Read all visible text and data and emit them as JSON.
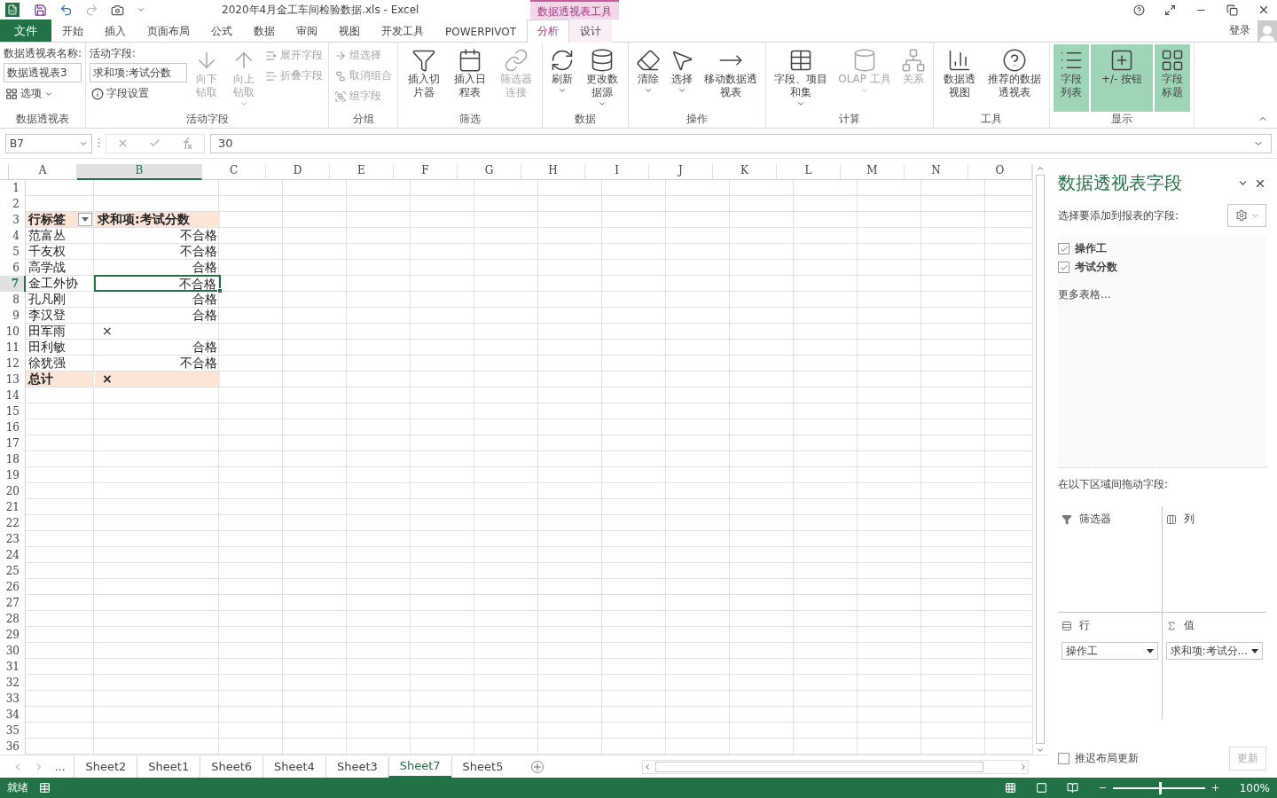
{
  "window": {
    "title": "2020年4月金工车间检验数据.xls - Excel",
    "context_tab": "数据透视表工具",
    "account": "登录"
  },
  "tabs": [
    {
      "label": "文件",
      "kind": "file",
      "selected": false
    },
    {
      "label": "开始",
      "kind": "tab",
      "selected": false
    },
    {
      "label": "插入",
      "kind": "tab",
      "selected": false
    },
    {
      "label": "页面布局",
      "kind": "tab",
      "selected": false
    },
    {
      "label": "公式",
      "kind": "tab",
      "selected": false
    },
    {
      "label": "数据",
      "kind": "tab",
      "selected": false
    },
    {
      "label": "审阅",
      "kind": "tab",
      "selected": false
    },
    {
      "label": "视图",
      "kind": "tab",
      "selected": false
    },
    {
      "label": "开发工具",
      "kind": "tab",
      "selected": false
    },
    {
      "label": "POWERPIVOT",
      "kind": "tab",
      "selected": false
    },
    {
      "label": "分析",
      "kind": "context",
      "selected": true
    },
    {
      "label": "设计",
      "kind": "context",
      "selected": false
    }
  ],
  "ribbon": [
    {
      "label": "数据透视表",
      "items": [
        {
          "kind": "caption",
          "label": "数据透视表名称:"
        },
        {
          "kind": "field",
          "value": "数据透视表3"
        },
        {
          "kind": "small",
          "label": "选项",
          "dropdown": true,
          "disabled": false
        }
      ]
    },
    {
      "label": "活动字段",
      "items": [
        {
          "kind": "caption",
          "label": "活动字段:"
        },
        {
          "kind": "field",
          "value": "求和项:考试分数"
        },
        {
          "kind": "small",
          "label": "字段设置",
          "dropdown": false,
          "disabled": false
        },
        {
          "kind": "big",
          "label": "向下钻取",
          "dropdown": false,
          "disabled": true,
          "selected": false
        },
        {
          "kind": "big",
          "label": "向上钻取",
          "dropdown": true,
          "disabled": true,
          "selected": false
        },
        {
          "kind": "small",
          "label": "展开字段",
          "dropdown": false,
          "disabled": true
        },
        {
          "kind": "small",
          "label": "折叠字段",
          "dropdown": false,
          "disabled": true
        }
      ]
    },
    {
      "label": "分组",
      "items": [
        {
          "kind": "small",
          "label": "组选择",
          "dropdown": false,
          "disabled": true
        },
        {
          "kind": "small",
          "label": "取消组合",
          "dropdown": false,
          "disabled": true
        },
        {
          "kind": "small",
          "label": "组字段",
          "dropdown": false,
          "disabled": true
        }
      ]
    },
    {
      "label": "筛选",
      "items": [
        {
          "kind": "big",
          "label": "插入切片器",
          "dropdown": false,
          "disabled": false,
          "selected": false
        },
        {
          "kind": "big",
          "label": "插入日程表",
          "dropdown": false,
          "disabled": false,
          "selected": false
        },
        {
          "kind": "big",
          "label": "筛选器连接",
          "dropdown": false,
          "disabled": true,
          "selected": false
        }
      ]
    },
    {
      "label": "数据",
      "items": [
        {
          "kind": "big",
          "label": "刷新",
          "dropdown": true,
          "disabled": false,
          "selected": false
        },
        {
          "kind": "big",
          "label": "更改数据源",
          "dropdown": true,
          "disabled": false,
          "selected": false
        }
      ]
    },
    {
      "label": "操作",
      "items": [
        {
          "kind": "big",
          "label": "清除",
          "dropdown": true,
          "disabled": false,
          "selected": false
        },
        {
          "kind": "big",
          "label": "选择",
          "dropdown": true,
          "disabled": false,
          "selected": false
        },
        {
          "kind": "big",
          "label": "移动数据透视表",
          "dropdown": false,
          "disabled": false,
          "selected": false
        }
      ]
    },
    {
      "label": "计算",
      "items": [
        {
          "kind": "big",
          "label": "字段、项目和集",
          "dropdown": true,
          "disabled": false,
          "selected": false
        },
        {
          "kind": "big",
          "label": "OLAP 工具",
          "dropdown": true,
          "disabled": true,
          "selected": false
        },
        {
          "kind": "big",
          "label": "关系",
          "dropdown": false,
          "disabled": true,
          "selected": false
        }
      ]
    },
    {
      "label": "工具",
      "items": [
        {
          "kind": "big",
          "label": "数据透视图",
          "dropdown": false,
          "disabled": false,
          "selected": false
        },
        {
          "kind": "big",
          "label": "推荐的数据透视表",
          "dropdown": false,
          "disabled": false,
          "selected": false
        }
      ]
    },
    {
      "label": "显示",
      "items": [
        {
          "kind": "big",
          "label": "字段列表",
          "dropdown": false,
          "disabled": false,
          "selected": true
        },
        {
          "kind": "big",
          "label": "+/- 按钮",
          "dropdown": false,
          "disabled": false,
          "selected": true
        },
        {
          "kind": "big",
          "label": "字段标题",
          "dropdown": false,
          "disabled": false,
          "selected": true
        }
      ]
    }
  ],
  "formula_bar": {
    "name_box": "B7",
    "value": "30"
  },
  "sheet": {
    "columns": [
      {
        "label": "A",
        "selected": false
      },
      {
        "label": "B",
        "selected": true
      },
      {
        "label": "C",
        "selected": false
      },
      {
        "label": "D",
        "selected": false
      },
      {
        "label": "E",
        "selected": false
      },
      {
        "label": "F",
        "selected": false
      },
      {
        "label": "G",
        "selected": false
      },
      {
        "label": "H",
        "selected": false
      },
      {
        "label": "I",
        "selected": false
      },
      {
        "label": "J",
        "selected": false
      },
      {
        "label": "K",
        "selected": false
      },
      {
        "label": "L",
        "selected": false
      },
      {
        "label": "M",
        "selected": false
      },
      {
        "label": "N",
        "selected": false
      },
      {
        "label": "O",
        "selected": false
      }
    ],
    "rows": [
      {
        "label": "1",
        "selected": false,
        "kind": "blank"
      },
      {
        "label": "2",
        "selected": false,
        "kind": "blank"
      },
      {
        "label": "3",
        "selected": false,
        "kind": "header",
        "a": "行标签",
        "b": {
          "text": "求和项:考试分数",
          "kind": "label",
          "selected": false
        }
      },
      {
        "label": "4",
        "selected": false,
        "kind": "item",
        "a": "范富丛",
        "b": {
          "text": "不合格",
          "kind": "value",
          "selected": false
        }
      },
      {
        "label": "5",
        "selected": false,
        "kind": "item",
        "a": "千友权",
        "b": {
          "text": "不合格",
          "kind": "value",
          "selected": false
        }
      },
      {
        "label": "6",
        "selected": false,
        "kind": "item",
        "a": "高学战",
        "b": {
          "text": "合格",
          "kind": "value",
          "selected": false
        }
      },
      {
        "label": "7",
        "selected": true,
        "kind": "item",
        "a": "金工外协",
        "b": {
          "text": "不合格",
          "kind": "value",
          "selected": true
        }
      },
      {
        "label": "8",
        "selected": false,
        "kind": "item",
        "a": "孔凡刚",
        "b": {
          "text": "合格",
          "kind": "value",
          "selected": false
        }
      },
      {
        "label": "9",
        "selected": false,
        "kind": "item",
        "a": "李汉登",
        "b": {
          "text": "合格",
          "kind": "value",
          "selected": false
        }
      },
      {
        "label": "10",
        "selected": false,
        "kind": "item",
        "a": "田军雨",
        "b": {
          "text": "×",
          "kind": "mark",
          "selected": false
        }
      },
      {
        "label": "11",
        "selected": false,
        "kind": "item",
        "a": "田利敏",
        "b": {
          "text": "合格",
          "kind": "value",
          "selected": false
        }
      },
      {
        "label": "12",
        "selected": false,
        "kind": "item",
        "a": "徐犹强",
        "b": {
          "text": "不合格",
          "kind": "value",
          "selected": false
        }
      },
      {
        "label": "13",
        "selected": false,
        "kind": "total",
        "a": "总计",
        "b": {
          "text": "×",
          "kind": "mark",
          "selected": false
        }
      },
      {
        "label": "14",
        "selected": false,
        "kind": "blank"
      },
      {
        "label": "15",
        "selected": false,
        "kind": "blank"
      },
      {
        "label": "16",
        "selected": false,
        "kind": "blank"
      },
      {
        "label": "17",
        "selected": false,
        "kind": "blank"
      },
      {
        "label": "18",
        "selected": false,
        "kind": "blank"
      },
      {
        "label": "19",
        "selected": false,
        "kind": "blank"
      },
      {
        "label": "20",
        "selected": false,
        "kind": "blank"
      },
      {
        "label": "21",
        "selected": false,
        "kind": "blank"
      },
      {
        "label": "22",
        "selected": false,
        "kind": "blank"
      },
      {
        "label": "23",
        "selected": false,
        "kind": "blank"
      },
      {
        "label": "24",
        "selected": false,
        "kind": "blank"
      },
      {
        "label": "25",
        "selected": false,
        "kind": "blank"
      },
      {
        "label": "26",
        "selected": false,
        "kind": "blank"
      },
      {
        "label": "27",
        "selected": false,
        "kind": "blank"
      },
      {
        "label": "28",
        "selected": false,
        "kind": "blank"
      },
      {
        "label": "29",
        "selected": false,
        "kind": "blank"
      },
      {
        "label": "30",
        "selected": false,
        "kind": "blank"
      },
      {
        "label": "31",
        "selected": false,
        "kind": "blank"
      },
      {
        "label": "32",
        "selected": false,
        "kind": "blank"
      },
      {
        "label": "33",
        "selected": false,
        "kind": "blank"
      },
      {
        "label": "34",
        "selected": false,
        "kind": "blank"
      },
      {
        "label": "35",
        "selected": false,
        "kind": "blank"
      },
      {
        "label": "36",
        "selected": false,
        "kind": "blank"
      }
    ]
  },
  "sheet_tabs": {
    "more": "...",
    "tabs": [
      {
        "label": "Sheet2",
        "selected": false
      },
      {
        "label": "Sheet1",
        "selected": false
      },
      {
        "label": "Sheet6",
        "selected": false
      },
      {
        "label": "Sheet4",
        "selected": false
      },
      {
        "label": "Sheet3",
        "selected": false
      },
      {
        "label": "Sheet7",
        "selected": true
      },
      {
        "label": "Sheet5",
        "selected": false
      }
    ]
  },
  "field_pane": {
    "title": "数据透视表字段",
    "prompt": "选择要添加到报表的字段:",
    "fields": [
      {
        "label": "操作工",
        "checked": true
      },
      {
        "label": "考试分数",
        "checked": true
      }
    ],
    "more_tables": "更多表格...",
    "drag_prompt": "在以下区域间拖动字段:",
    "areas": [
      {
        "kind": "filter",
        "title": "筛选器"
      },
      {
        "kind": "columns",
        "title": "列"
      },
      {
        "kind": "rows",
        "title": "行",
        "items": [
          "操作工"
        ]
      },
      {
        "kind": "values",
        "title": "值",
        "items": [
          "求和项:考试分..."
        ]
      }
    ],
    "defer": {
      "label": "推迟布局更新",
      "checked": false
    },
    "update": {
      "label": "更新",
      "disabled": true
    }
  },
  "status_bar": {
    "status": "就绪",
    "zoom": "100%",
    "zoom_level": {
      "level": 0.5
    }
  }
}
